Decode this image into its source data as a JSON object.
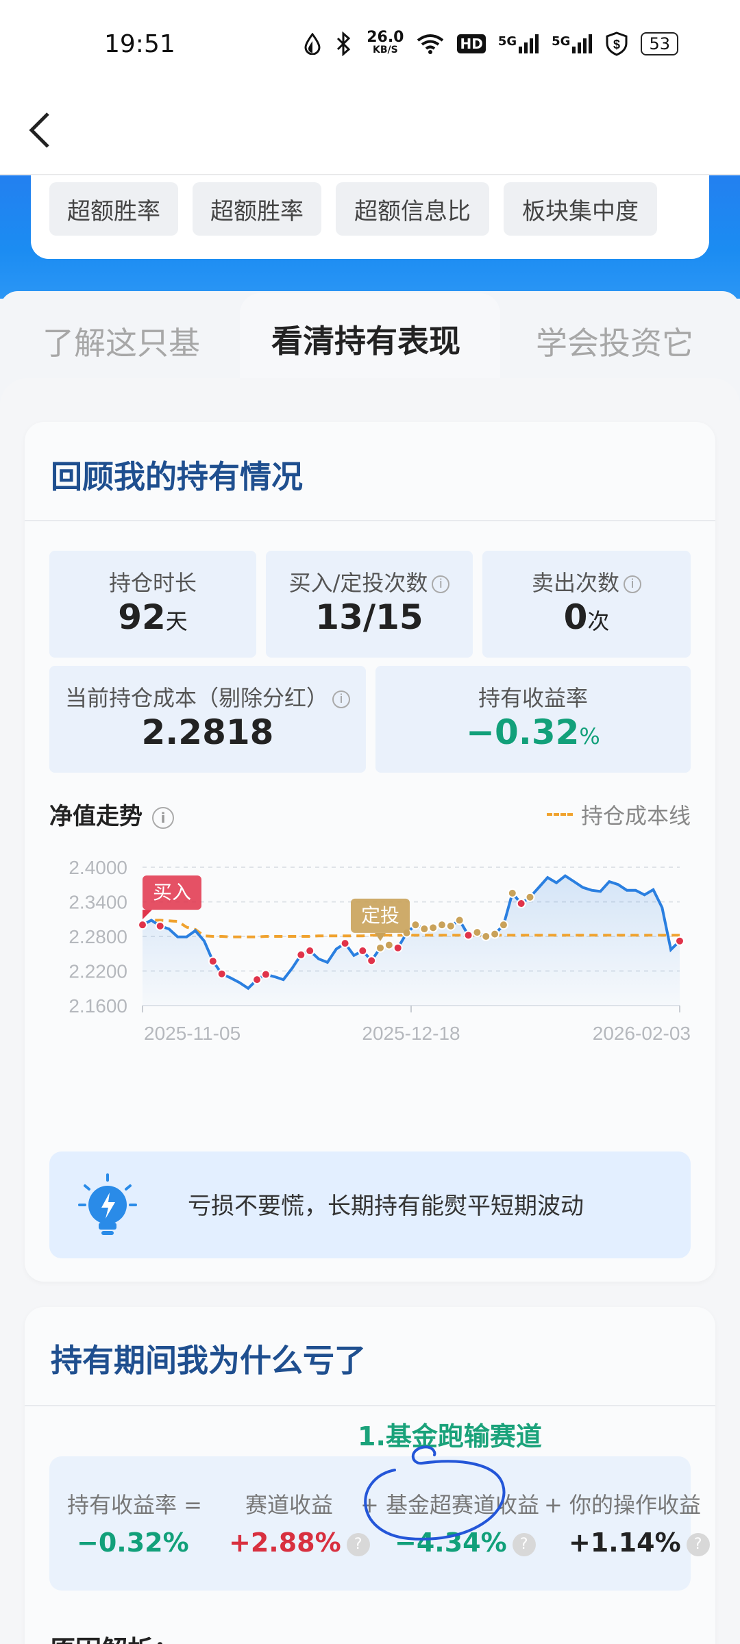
{
  "status_bar": {
    "time": "19:51",
    "net_speed": "26.0",
    "net_unit": "KB/S",
    "hd_badge": "HD",
    "sig1": "5G",
    "sig2": "5G",
    "battery": "53"
  },
  "nav": {
    "back_icon": "chevron-left-icon"
  },
  "tags": [
    "超额胜率",
    "超额胜率",
    "超额信息比",
    "板块集中度"
  ],
  "tabs": [
    "了解这只基",
    "看清持有表现",
    "学会投资它"
  ],
  "active_tab": 1,
  "holding_card": {
    "title": "回顾我的持有情况",
    "stats": {
      "duration_label": "持仓时长",
      "duration_value": "92",
      "duration_unit": "天",
      "buys_label": "买入/定投次数",
      "buys_value": "13/15",
      "sells_label": "卖出次数",
      "sells_value": "0",
      "sells_unit": "次",
      "cost_label": "当前持仓成本（剔除分红）",
      "cost_value": "2.2818",
      "return_label": "持有收益率",
      "return_value": "−0.32",
      "return_unit": "%"
    },
    "chart_title": "净值走势",
    "legend_label": "持仓成本线",
    "tip_text": "亏损不要慌，长期持有能熨平短期波动"
  },
  "chart_data": {
    "type": "line",
    "ylim": [
      2.16,
      2.4
    ],
    "y_ticks": [
      "2.4000",
      "2.3400",
      "2.2800",
      "2.2200",
      "2.1600"
    ],
    "x_ticks": [
      "2025-11-05",
      "2025-12-18",
      "2026-02-03"
    ],
    "series": [
      {
        "values": [
          2.3,
          2.308,
          2.298,
          2.293,
          2.279,
          2.279,
          2.29,
          2.272,
          2.237,
          2.215,
          2.208,
          2.2,
          2.19,
          2.205,
          2.214,
          2.21,
          2.205,
          2.225,
          2.248,
          2.255,
          2.241,
          2.235,
          2.258,
          2.268,
          2.247,
          2.255,
          2.238,
          2.26,
          2.265,
          2.26,
          2.286,
          2.3,
          2.293,
          2.295,
          2.3,
          2.298,
          2.308,
          2.282,
          2.287,
          2.28,
          2.284,
          2.3,
          2.355,
          2.337,
          2.348,
          2.365,
          2.382,
          2.373,
          2.385,
          2.375,
          2.365,
          2.36,
          2.358,
          2.375,
          2.37,
          2.36,
          2.36,
          2.352,
          2.361,
          2.33,
          2.257,
          2.272
        ]
      },
      {
        "values": [
          2.3,
          2.308,
          2.308,
          2.307,
          2.306,
          2.296,
          2.292,
          2.281,
          2.28,
          2.28,
          2.279,
          2.279,
          2.279,
          2.279,
          2.28,
          2.28,
          2.28,
          2.28,
          2.28,
          2.28,
          2.281,
          2.281,
          2.281,
          2.281,
          2.281,
          2.281,
          2.282,
          2.282,
          2.282,
          2.282,
          2.282,
          2.282,
          2.282,
          2.282,
          2.282,
          2.282,
          2.282,
          2.282,
          2.282,
          2.282,
          2.282,
          2.282,
          2.282,
          2.282,
          2.282,
          2.282,
          2.282,
          2.282,
          2.282,
          2.282,
          2.282,
          2.282,
          2.282,
          2.282,
          2.282,
          2.282,
          2.282,
          2.282,
          2.282,
          2.282,
          2.282,
          2.282
        ]
      }
    ],
    "buy_points": [
      0,
      2,
      8,
      9,
      13,
      14,
      18,
      19,
      23,
      25,
      26,
      29,
      37,
      43,
      61
    ],
    "sip_points": [
      27,
      28,
      30,
      31,
      32,
      33,
      34,
      35,
      36,
      38,
      39,
      40,
      41,
      42,
      44
    ],
    "annotations": [
      {
        "label": "买入",
        "at": 0
      },
      {
        "label": "定投",
        "at": 27
      }
    ],
    "colors": {
      "nav_line": "#2a7fe0",
      "cost_line": "#f0a22e",
      "buy": "#e0334a",
      "sip": "#c9a25a"
    }
  },
  "loss_card": {
    "title": "持有期间我为什么亏了",
    "annotation": "1.基金跑输赛道",
    "formula": {
      "l1": "持有收益率 =",
      "l2": "赛道收益",
      "l3": "+ 基金超赛道收益",
      "l4": "+ 你的操作收益",
      "v1": "−0.32%",
      "v2": "+2.88%",
      "v3": "−4.34%",
      "v4": "+1.14%",
      "help": "?"
    },
    "reason_label": "原因解析："
  }
}
